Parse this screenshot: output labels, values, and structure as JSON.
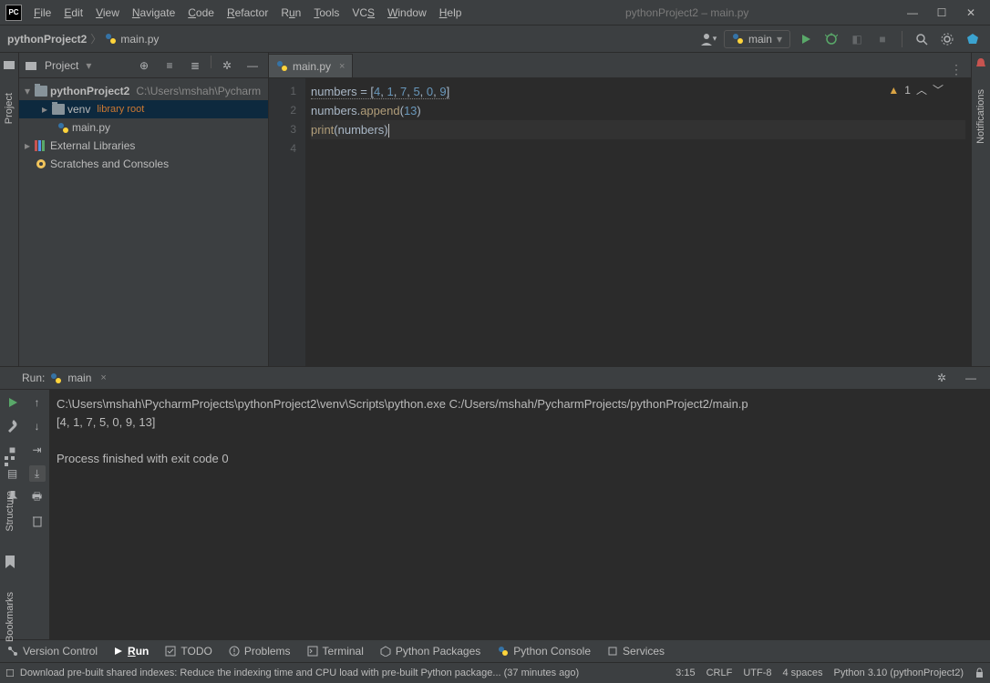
{
  "window": {
    "title": "pythonProject2 – main.py"
  },
  "menu": [
    "File",
    "Edit",
    "View",
    "Navigate",
    "Code",
    "Refactor",
    "Run",
    "Tools",
    "VCS",
    "Window",
    "Help"
  ],
  "breadcrumb": {
    "project": "pythonProject2",
    "file": "main.py"
  },
  "run_config": {
    "name": "main"
  },
  "project_panel": {
    "title": "Project",
    "root": {
      "name": "pythonProject2",
      "path": "C:\\Users\\mshah\\Pycharm"
    },
    "venv": {
      "name": "venv",
      "tag": "library root"
    },
    "mainfile": "main.py",
    "ext_lib": "External Libraries",
    "scratches": "Scratches and Consoles"
  },
  "editor": {
    "tab": "main.py",
    "gutter": [
      "1",
      "2",
      "3",
      "4"
    ],
    "line1": {
      "var": "numbers",
      "eq": " = ",
      "br1": "[",
      "n": [
        "4",
        ", ",
        "1",
        ", ",
        "7",
        ", ",
        "5",
        ", ",
        "0",
        ", ",
        "9"
      ],
      "br2": "]"
    },
    "line2": {
      "v": "numbers",
      "dot": ".",
      "fn": "append",
      "p1": "(",
      "arg": "13",
      "p2": ")"
    },
    "line3": {
      "fn": "print",
      "p1": "(",
      "arg": "numbers",
      "p2": ")"
    },
    "warn_count": "1"
  },
  "run_panel": {
    "label": "Run:",
    "tab": "main",
    "output_line1": "C:\\Users\\mshah\\PycharmProjects\\pythonProject2\\venv\\Scripts\\python.exe C:/Users/mshah/PycharmProjects/pythonProject2/main.p",
    "output_line2": "[4, 1, 7, 5, 0, 9, 13]",
    "output_line3": "",
    "output_line4": "Process finished with exit code 0"
  },
  "bottom_tools": {
    "version": "Version Control",
    "run": "Run",
    "todo": "TODO",
    "problems": "Problems",
    "terminal": "Terminal",
    "pkg": "Python Packages",
    "console": "Python Console",
    "services": "Services"
  },
  "status": {
    "msg": "Download pre-built shared indexes: Reduce the indexing time and CPU load with pre-built Python package... (37 minutes ago)",
    "pos": "3:15",
    "eol": "CRLF",
    "enc": "UTF-8",
    "indent": "4 spaces",
    "interp": "Python 3.10 (pythonProject2)"
  },
  "side": {
    "project": "Project",
    "structure": "Structure",
    "bookmarks": "Bookmarks",
    "notifications": "Notifications"
  }
}
